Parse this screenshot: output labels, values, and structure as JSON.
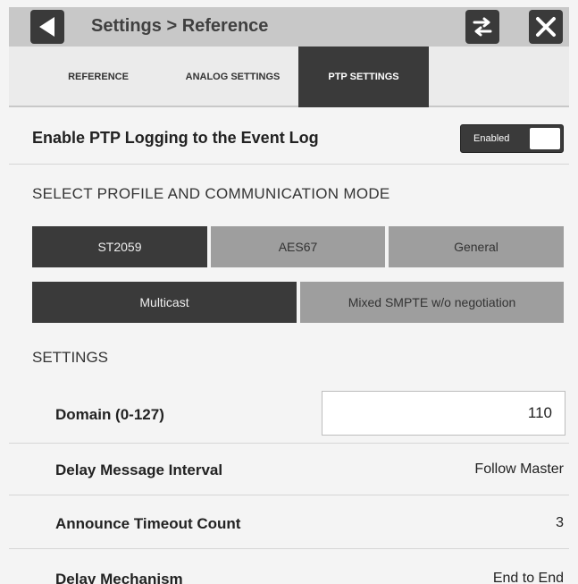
{
  "header": {
    "title": "Settings > Reference",
    "back_icon": "back-arrow-icon",
    "swap_icon": "swap-icon",
    "close_icon": "close-icon"
  },
  "tabs": [
    {
      "label": "REFERENCE",
      "selected": false
    },
    {
      "label": "ANALOG SETTINGS",
      "selected": false
    },
    {
      "label": "PTP SETTINGS",
      "selected": true
    }
  ],
  "logging": {
    "label": "Enable PTP Logging to the Event Log",
    "toggle_text": "Enabled",
    "enabled": true
  },
  "profile_section": {
    "heading": "SELECT PROFILE AND COMMUNICATION MODE",
    "profiles": [
      {
        "label": "ST2059",
        "selected": true
      },
      {
        "label": "AES67",
        "selected": false
      },
      {
        "label": "General",
        "selected": false
      }
    ],
    "modes": [
      {
        "label": "Multicast",
        "selected": true
      },
      {
        "label": "Mixed SMPTE w/o negotiation",
        "selected": false
      }
    ]
  },
  "settings": {
    "heading": "SETTINGS",
    "domain": {
      "label": "Domain (0-127)",
      "value": "110"
    },
    "delay_message_interval": {
      "label": "Delay Message Interval",
      "value": "Follow Master"
    },
    "announce_timeout_count": {
      "label": "Announce Timeout Count",
      "value": "3"
    },
    "delay_mechanism": {
      "label": "Delay Mechanism",
      "value": "End to End"
    }
  },
  "colors": {
    "selected": "#3a3a3a",
    "unselected": "#9e9e9e",
    "titlebar": "#c8c8c8",
    "background": "#f4f4f4"
  }
}
